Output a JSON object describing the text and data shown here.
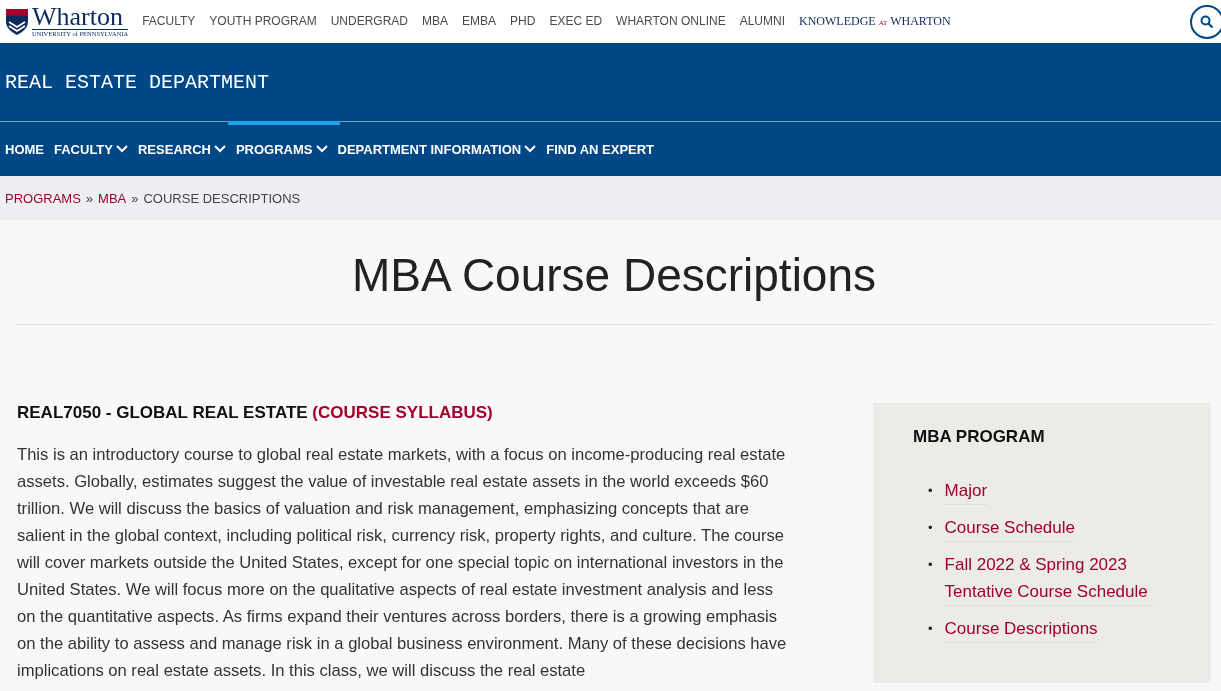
{
  "header": {
    "logo": {
      "name": "Wharton",
      "subtitle": "UNIVERSITY of PENNSYLVANIA"
    },
    "top_nav": [
      "FACULTY",
      "YOUTH PROGRAM",
      "UNDERGRAD",
      "MBA",
      "EMBA",
      "PHD",
      "EXEC ED",
      "WHARTON ONLINE",
      "ALUMNI"
    ],
    "knowledge_link": {
      "before": "KNOWLEDGE",
      "middle": "AT",
      "after": "WHARTON"
    }
  },
  "department": {
    "title": "REAL ESTATE DEPARTMENT"
  },
  "dept_nav": [
    {
      "label": "HOME",
      "dropdown": false,
      "selected": false
    },
    {
      "label": "FACULTY",
      "dropdown": true,
      "selected": false
    },
    {
      "label": "RESEARCH",
      "dropdown": true,
      "selected": false
    },
    {
      "label": "PROGRAMS",
      "dropdown": true,
      "selected": true
    },
    {
      "label": "DEPARTMENT INFORMATION",
      "dropdown": true,
      "selected": false
    },
    {
      "label": "FIND AN EXPERT",
      "dropdown": false,
      "selected": false
    }
  ],
  "breadcrumb": [
    {
      "kind": "link",
      "text": "PROGRAMS"
    },
    {
      "kind": "sep",
      "text": "»"
    },
    {
      "kind": "link",
      "text": "MBA"
    },
    {
      "kind": "sep",
      "text": "»"
    },
    {
      "kind": "current",
      "text": "COURSE DESCRIPTIONS"
    }
  ],
  "page_title": "MBA Course Descriptions",
  "course": {
    "code_title": "REAL7050 - GLOBAL REAL ESTATE",
    "syllabus_link": "(COURSE SYLLABUS)",
    "description": "This is an introductory course to global real estate markets, with a focus on income-producing real estate assets. Globally, estimates suggest the value of investable real estate assets in the world exceeds $60 trillion. We will discuss the basics of valuation and risk management, emphasizing concepts that are salient in the global context, including political risk, currency risk, property rights, and culture. The course will cover markets outside the United States, except for one special topic on international investors in the United States. We will focus more on the qualitative aspects of real estate investment analysis and less on the quantitative aspects. As firms expand their ventures across borders, there is a growing emphasis on the ability to assess and manage risk in a global business environment. Many of these decisions have implications on real estate assets. In this class, we will discuss the real estate"
  },
  "sidebar": {
    "title": "MBA PROGRAM",
    "links": [
      {
        "bullet": "•",
        "text": "Major"
      },
      {
        "bullet": "•",
        "text": "Course Schedule"
      },
      {
        "bullet": "•",
        "text": "Fall 2022 & Spring 2023 Tentative Course Schedule"
      },
      {
        "bullet": "•",
        "text": "Course Descriptions"
      }
    ]
  }
}
